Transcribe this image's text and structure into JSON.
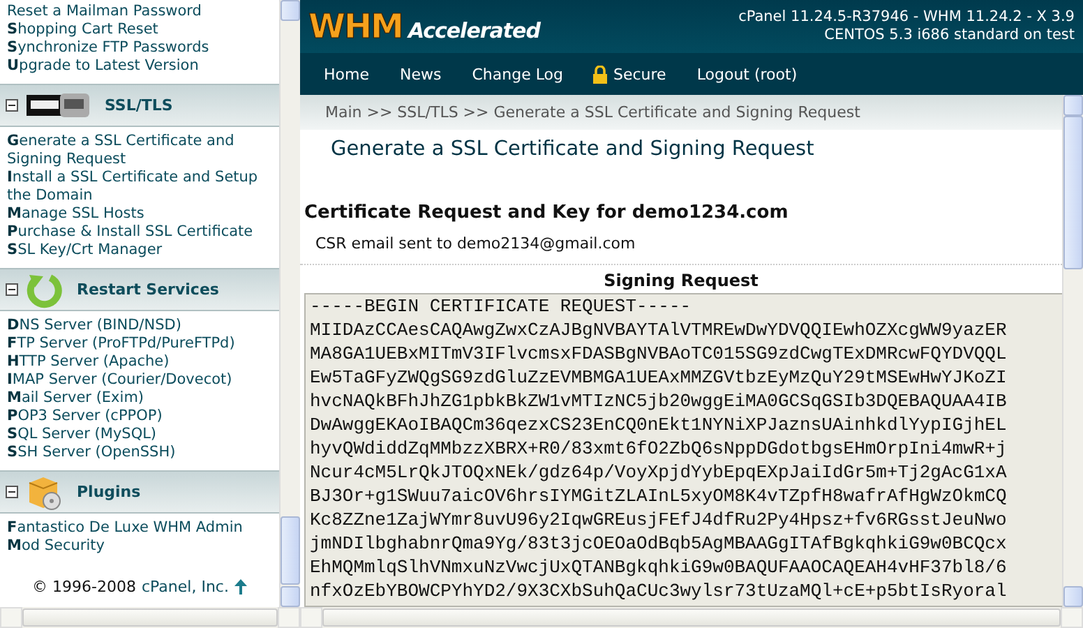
{
  "sidebar": {
    "top_items": [
      "Reset a Mailman Password",
      "**S**hopping Cart Reset",
      "**S**ynchronize FTP Passwords",
      "**U**pgrade to Latest Version"
    ],
    "sections": [
      {
        "title": "SSL/TLS",
        "kind": "modssl",
        "expanded": true,
        "items": [
          "**G**enerate a SSL Certificate and Signing Request",
          "**I**nstall a SSL Certificate and Setup the Domain",
          "**M**anage SSL Hosts",
          "**P**urchase & Install SSL Certificate",
          "**S**SL Key/Crt Manager"
        ]
      },
      {
        "title": "Restart Services",
        "kind": "restart",
        "expanded": true,
        "items": [
          "**D**NS Server (BIND/NSD)",
          "**F**TP Server (ProFTPd/PureFTPd)",
          "**H**TTP Server (Apache)",
          "**I**MAP Server (Courier/Dovecot)",
          "**M**ail Server (Exim)",
          "**P**OP3 Server (cPPOP)",
          "**S**QL Server (MySQL)",
          "**S**SH Server (OpenSSH)"
        ]
      },
      {
        "title": "Plugins",
        "kind": "plugins",
        "expanded": true,
        "items": [
          "**F**antastico De Luxe WHM Admin",
          "**M**od Security"
        ]
      }
    ],
    "footer": {
      "copyright": "© 1996-2008",
      "link": "cPanel, Inc."
    }
  },
  "header": {
    "logo_main": "WHM",
    "logo_sub": "Accelerated",
    "version_lines": [
      "cPanel 11.24.5-R37946 - WHM 11.24.2 - X 3.9",
      "CENTOS 5.3 i686 standard on test"
    ]
  },
  "nav": [
    {
      "label": "Home",
      "kind": "plain"
    },
    {
      "label": "News",
      "kind": "plain"
    },
    {
      "label": "Change Log",
      "kind": "plain"
    },
    {
      "label": "Secure",
      "kind": "lock"
    },
    {
      "label": "Logout (root)",
      "kind": "plain"
    }
  ],
  "breadcrumb": "Main >> SSL/TLS >> Generate a SSL Certificate and Signing Request",
  "page_title": "Generate a SSL Certificate and Signing Request",
  "result_heading": "Certificate Request and Key for demo1234.com",
  "notice": "CSR email sent to demo2134@gmail.com",
  "signing_request": {
    "title": "Signing Request",
    "lines": [
      "-----BEGIN CERTIFICATE REQUEST-----",
      "MIIDAzCCAesCAQAwgZwxCzAJBgNVBAYTAlVTMREwDwYDVQQIEwhOZXcgWW9yazER",
      "MA8GA1UEBxMITmV3IFlvcmsxFDASBgNVBAoTC015SG9zdCwgTExDMRcwFQYDVQQL",
      "Ew5TaGFyZWQgSG9zdGluZzEVMBMGA1UEAxMMZGVtbzEyMzQuY29tMSEwHwYJKoZI",
      "hvcNAQkBFhJhZG1pbkBkZW1vMTIzNC5jb20wggEiMA0GCSqGSIb3DQEBAQUAA4IB",
      "DwAwggEKAoIBAQCm36qezxCS23EnCQ0nEkt1NYNiXPJaznsUAinhkdlYypIGjhEL",
      "hyvQWdiddZqMMbzzXBRX+R0/83xmt6fO2ZbQ6sNppDGdotbgsEHmOrpIni4mwR+j",
      "Ncur4cM5LrQkJTOQxNEk/gdz64p/VoyXpjdYybEpqEXpJaiIdGr5m+Tj2gAcG1xA",
      "BJ3Or+g1SWuu7aicOV6hrsIYMGitZLAInL5xyOM8K4vTZpfH8wafrAfHgWzOkmCQ",
      "Kc8ZZne1ZajWYmr8uvU96y2IqwGREusjFEfJ4dfRu2Py4Hpsz+fv6RGsstJeuNwo",
      "jmNDIlbghabnrQma9Yg/83t3jcOEOaOdBqb5AgMBAAGgITAfBgkqhkiG9w0BCQcx",
      "EhMQMmlqSlhVNmxuNzVwcjUxQTANBgkqhkiG9w0BAQUFAAOCAQEAH4vHF37bl8/6",
      "nfxOzEbYBOWCPYhYD2/9X3CXbSuhQaCUc3wylsr73tUzaMQl+cE+p5btIsRyoral"
    ]
  }
}
